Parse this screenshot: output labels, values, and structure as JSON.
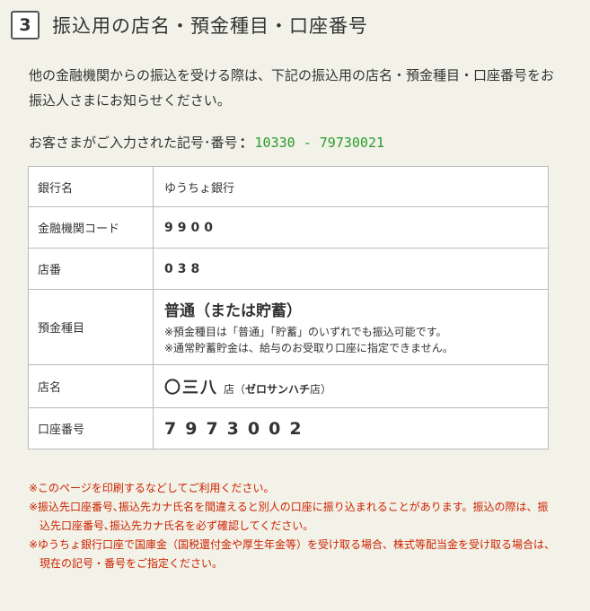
{
  "header": {
    "step_number": "3",
    "title": "振込用の店名・預金種目・口座番号"
  },
  "intro": {
    "text": "他の金融機関からの振込を受ける際は、下記の振込用の店名・預金種目・口座番号をお振込人さまにお知らせください。"
  },
  "entered_code": {
    "label": "お客さまがご入力された記号･番号",
    "colon": "：",
    "value": "10330 - 79730021"
  },
  "table": {
    "bank": {
      "label": "銀行名",
      "value": "ゆうちょ銀行"
    },
    "institution_code": {
      "label": "金融機関コード",
      "value": "9900"
    },
    "branch_number": {
      "label": "店番",
      "value": "038"
    },
    "deposit_type": {
      "label": "預金種目",
      "value": "普通（または貯蓄）",
      "note1": "※預金種目は「普通」「貯蓄」のいずれでも振込可能です。",
      "note2": "※通常貯蓄貯金は、給与のお受取り口座に指定できません。"
    },
    "branch_name": {
      "label": "店名",
      "value": "〇三八",
      "suffix": "店",
      "reading_open": "（",
      "reading": "ゼロサンハチ",
      "reading_suffix": "店",
      "reading_close": "）"
    },
    "account_number": {
      "label": "口座番号",
      "value": "7973002"
    }
  },
  "notes": [
    "※このページを印刷するなどしてご利用ください。",
    "※振込先口座番号､振込先カナ氏名を間違えると別人の口座に振り込まれることがあります。振込の際は、振込先口座番号､振込先カナ氏名を必ず確認してください。",
    "※ゆうちょ銀行口座で国庫金（国税還付金や厚生年金等）を受け取る場合、株式等配当金を受け取る場合は、現在の記号・番号をご指定ください。"
  ],
  "colors": {
    "background": "#f2f2e8",
    "code_value": "#2a9a2a",
    "notes": "#cc2200",
    "border": "#bbbbbb"
  }
}
